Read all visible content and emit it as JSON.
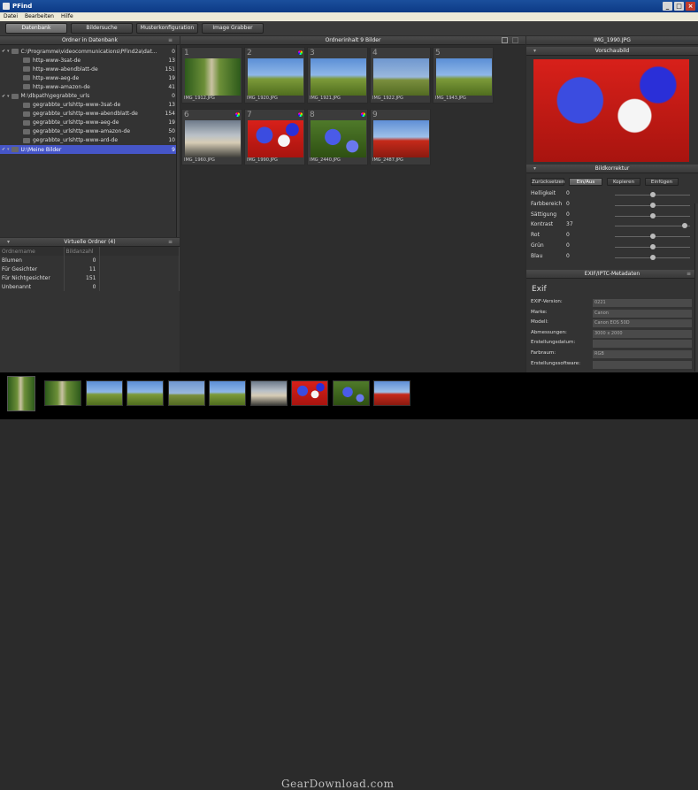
{
  "window": {
    "title": "PFind",
    "controls": [
      "_",
      "□",
      "×"
    ]
  },
  "menu": [
    "Datei",
    "Bearbeiten",
    "Hilfe"
  ],
  "toolbar": {
    "tabs": [
      "Datenbank",
      "Bildersuche",
      "Musterkonfiguration",
      "Image Grabber"
    ],
    "active": "Datenbank"
  },
  "left_panel": {
    "title": "Ordner in Datenbank",
    "tree": [
      {
        "label": "C:\\Programme\\videocommunications\\PFind2a\\dat...",
        "count": "0",
        "level": 0,
        "checked": true
      },
      {
        "label": "http-www-3sat-de",
        "count": "13",
        "level": 1,
        "checked": false
      },
      {
        "label": "http-www-abendblatt-de",
        "count": "151",
        "level": 1,
        "checked": false
      },
      {
        "label": "http-www-aeg-de",
        "count": "19",
        "level": 1,
        "checked": false
      },
      {
        "label": "http-www-amazon-de",
        "count": "41",
        "level": 1,
        "checked": false
      },
      {
        "label": "M:\\dbpath\\gegrabbte_urls",
        "count": "0",
        "level": 0,
        "checked": true
      },
      {
        "label": "gegrabbte_urlshttp-www-3sat-de",
        "count": "13",
        "level": 1,
        "checked": false
      },
      {
        "label": "gegrabbte_urlshttp-www-abendblatt-de",
        "count": "154",
        "level": 1,
        "checked": false
      },
      {
        "label": "gegrabbte_urlshttp-www-aeg-de",
        "count": "19",
        "level": 1,
        "checked": false
      },
      {
        "label": "gegrabbte_urlshttp-www-amazon-de",
        "count": "50",
        "level": 1,
        "checked": false
      },
      {
        "label": "gegrabbte_urlshttp-www-ard-de",
        "count": "10",
        "level": 1,
        "checked": false
      },
      {
        "label": "U:\\Meine Bilder",
        "count": "9",
        "level": 0,
        "checked": true,
        "selected": true
      }
    ],
    "virtual_title": "Virtuelle Ordner (4)",
    "virtual_headers": [
      "Ordnername",
      "Bildanzahl"
    ],
    "virtual_rows": [
      {
        "name": "Blumen",
        "count": "0"
      },
      {
        "name": "Für Gesichter",
        "count": "11"
      },
      {
        "name": "Für Nichtgesichter",
        "count": "151"
      },
      {
        "name": "Unbenannt",
        "count": "0"
      }
    ]
  },
  "center": {
    "title": "Ordnerinhalt 9 Bilder",
    "thumbs": [
      {
        "n": "1",
        "file": "IMG_1912.JPG",
        "style": "road",
        "dot": false
      },
      {
        "n": "2",
        "file": "IMG_1920.JPG",
        "style": "sky-field",
        "dot": true
      },
      {
        "n": "3",
        "file": "IMG_1921.JPG",
        "style": "sky-field",
        "dot": false
      },
      {
        "n": "4",
        "file": "IMG_1922.JPG",
        "style": "stone",
        "dot": false
      },
      {
        "n": "5",
        "file": "IMG_1943.JPG",
        "style": "sky-field",
        "dot": false
      },
      {
        "n": "6",
        "file": "IMG_1960.JPG",
        "style": "cloud",
        "dot": true
      },
      {
        "n": "7",
        "file": "IMG_1990.JPG",
        "style": "flowers",
        "dot": true
      },
      {
        "n": "8",
        "file": "IMG_2440.JPG",
        "style": "cornflower",
        "dot": true
      },
      {
        "n": "9",
        "file": "IMG_2487.JPG",
        "style": "poppies",
        "dot": false
      }
    ]
  },
  "right_panel": {
    "title": "IMG_1990.JPG",
    "preview_title": "Vorschaubild",
    "correction_title": "Bildkorrektur",
    "buttons": [
      "Zurücksetzen",
      "Ein/Aus",
      "Kopieren",
      "Einfügen"
    ],
    "sliders": [
      {
        "label": "Helligkeit",
        "value": "0",
        "level": 0.5
      },
      {
        "label": "Farbbereich",
        "value": "0",
        "level": 0.5
      },
      {
        "label": "Sättigung",
        "value": "0",
        "level": 0.5
      },
      {
        "label": "Kontrast",
        "value": "37",
        "level": 0.95
      },
      {
        "label": "Rot",
        "value": "0",
        "level": 0.5
      },
      {
        "label": "Grün",
        "value": "0",
        "level": 0.5
      },
      {
        "label": "Blau",
        "value": "0",
        "level": 0.5
      }
    ],
    "meta_title": "EXIF/IPTC-Metadaten",
    "exif_heading": "Exif",
    "meta": [
      {
        "label": "EXIF-Version:",
        "value": "0221"
      },
      {
        "label": "Marke:",
        "value": "Canon"
      },
      {
        "label": "Modell:",
        "value": "Canon EOS 50D"
      },
      {
        "label": "Abmessungen:",
        "value": "3000 x 2000"
      },
      {
        "label": "Erstellungsdatum:",
        "value": ""
      },
      {
        "label": "Farbraum:",
        "value": "RGB"
      },
      {
        "label": "Erstellungssoftware:",
        "value": ""
      }
    ]
  },
  "filmstrip": [
    "road",
    "sky-field",
    "sky-field",
    "stone",
    "sky-field",
    "cloud",
    "flowers",
    "cornflower",
    "poppies"
  ],
  "watermark": "GearDownload.com"
}
